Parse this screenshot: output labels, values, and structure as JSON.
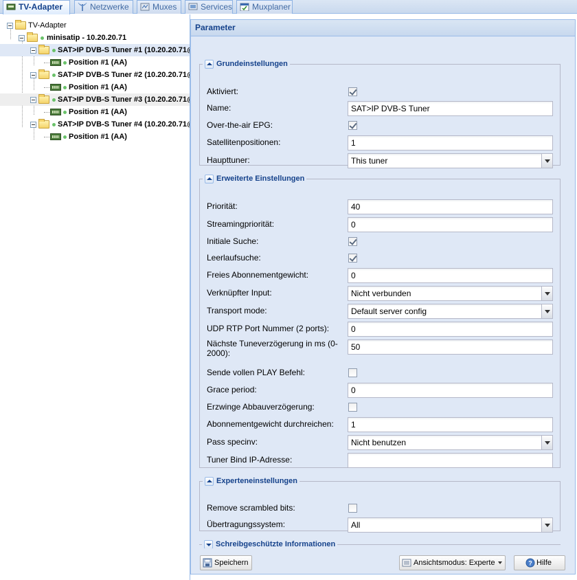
{
  "tabs": [
    {
      "label": "TV-Adapter",
      "icon": "tv-card-icon",
      "active": true
    },
    {
      "label": "Netzwerke",
      "icon": "antenna-icon",
      "active": false
    },
    {
      "label": "Muxes",
      "icon": "muxes-icon",
      "active": false
    },
    {
      "label": "Services",
      "icon": "services-icon",
      "active": false
    },
    {
      "label": "Muxplaner",
      "icon": "calendar-check-icon",
      "active": false
    }
  ],
  "tree": {
    "root": "TV-Adapter",
    "server": "minisatip - 10.20.20.71",
    "tuners": [
      {
        "label": "SAT>IP DVB-S Tuner #1 (10.20.20.71@",
        "position": "Position #1 (AA)"
      },
      {
        "label": "SAT>IP DVB-S Tuner #2 (10.20.20.71@",
        "position": "Position #1 (AA)"
      },
      {
        "label": "SAT>IP DVB-S Tuner #3 (10.20.20.71@",
        "position": "Position #1 (AA)"
      },
      {
        "label": "SAT>IP DVB-S Tuner #4 (10.20.20.71@",
        "position": "Position #1 (AA)"
      }
    ]
  },
  "panel": {
    "title": "Parameter",
    "basic": {
      "legend": "Grundeinstellungen",
      "enabled_label": "Aktiviert:",
      "name_label": "Name:",
      "name_value": "SAT>IP DVB-S Tuner",
      "ota_epg_label": "Over-the-air EPG:",
      "satpos_label": "Satellitenpositionen:",
      "satpos_value": "1",
      "master_label": "Haupttuner:",
      "master_value": "This tuner"
    },
    "advanced": {
      "legend": "Erweiterte Einstellungen",
      "priority_label": "Priorität:",
      "priority_value": "40",
      "stream_prio_label": "Streamingpriorität:",
      "stream_prio_value": "0",
      "initial_scan_label": "Initiale Suche:",
      "idle_scan_label": "Leerlaufsuche:",
      "free_weight_label": "Freies Abonnementgewicht:",
      "free_weight_value": "0",
      "linked_input_label": "Verknüpfter Input:",
      "linked_input_value": "Nicht verbunden",
      "transport_label": "Transport mode:",
      "transport_value": "Default server config",
      "udp_label": "UDP RTP Port Nummer (2 ports):",
      "udp_value": "0",
      "tune_delay_label": "Nächste Tuneverzögerung in ms (0-2000):",
      "tune_delay_value": "50",
      "full_play_label": "Sende vollen PLAY Befehl:",
      "grace_label": "Grace period:",
      "grace_value": "0",
      "teardown_label": "Erzwinge Abbauverzögerung:",
      "pass_weight_label": "Abonnementgewicht durchreichen:",
      "pass_weight_value": "1",
      "specinv_label": "Pass specinv:",
      "specinv_value": "Nicht benutzen",
      "bind_ip_label": "Tuner Bind IP-Adresse:",
      "bind_ip_value": ""
    },
    "expert": {
      "legend": "Experteneinstellungen",
      "scrambled_label": "Remove scrambled bits:",
      "delsys_label": "Übertragungssystem:",
      "delsys_value": "All"
    },
    "readonly": {
      "legend": "Schreibgeschützte Informationen"
    },
    "footer": {
      "save_label": "Speichern",
      "view_label": "Ansichtsmodus: Experte",
      "help_label": "Hilfe"
    }
  },
  "checkboxes": {
    "enabled": true,
    "ota_epg": true,
    "initial_scan": true,
    "idle_scan": true,
    "full_play": false,
    "teardown": false,
    "scrambled": false
  }
}
